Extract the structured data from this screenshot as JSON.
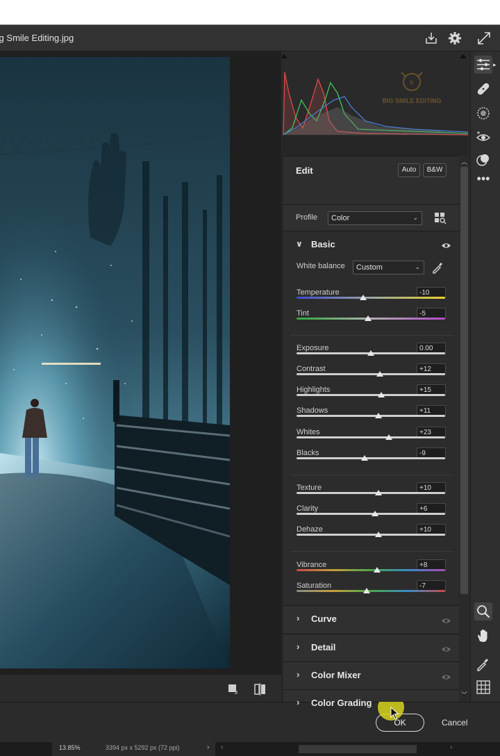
{
  "window": {
    "title": "Big Smile Editing.jpg"
  },
  "watermark": {
    "text": "BIG SMILE EDITING"
  },
  "edit": {
    "heading": "Edit",
    "auto_label": "Auto",
    "bw_label": "B&W"
  },
  "profile": {
    "label": "Profile",
    "value": "Color"
  },
  "basic": {
    "title": "Basic",
    "white_balance": {
      "label": "White balance",
      "value": "Custom"
    },
    "sliders": [
      {
        "label": "Temperature",
        "value": "-10"
      },
      {
        "label": "Tint",
        "value": "-5"
      },
      {
        "label": "Exposure",
        "value": "0.00"
      },
      {
        "label": "Contrast",
        "value": "+12"
      },
      {
        "label": "Highlights",
        "value": "+15"
      },
      {
        "label": "Shadows",
        "value": "+11"
      },
      {
        "label": "Whites",
        "value": "+23"
      },
      {
        "label": "Blacks",
        "value": "-9"
      },
      {
        "label": "Texture",
        "value": "+10"
      },
      {
        "label": "Clarity",
        "value": "+6"
      },
      {
        "label": "Dehaze",
        "value": "+10"
      },
      {
        "label": "Vibrance",
        "value": "+8"
      },
      {
        "label": "Saturation",
        "value": "-7"
      }
    ]
  },
  "sections": [
    {
      "title": "Curve"
    },
    {
      "title": "Detail"
    },
    {
      "title": "Color Mixer"
    },
    {
      "title": "Color Grading"
    }
  ],
  "footer": {
    "ok_label": "OK",
    "cancel_label": "Cancel"
  },
  "status": {
    "zoom": "13.85%",
    "dimensions": "3394 px x 5292 px (72 ppi)"
  },
  "colors": {
    "panel_bg": "#2c2c2c",
    "accent_cursor": "#d6d31c",
    "temp_gradient_start": "#3b4bd0",
    "temp_gradient_end": "#e8d22e",
    "tint_gradient_start": "#2fa83c",
    "tint_gradient_end": "#b44bc8"
  }
}
